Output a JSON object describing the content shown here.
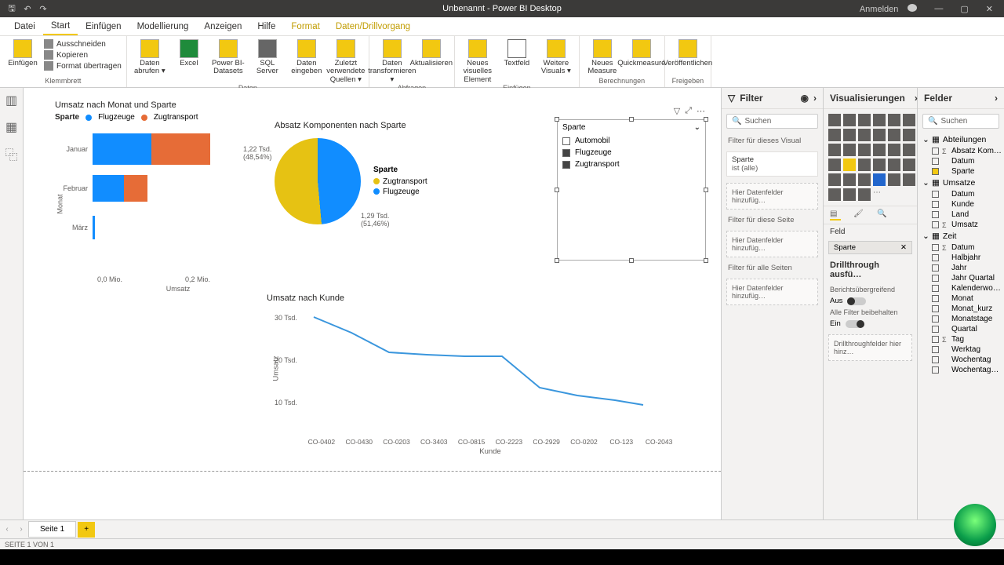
{
  "titlebar": {
    "title": "Unbenannt - Power BI Desktop",
    "signin": "Anmelden"
  },
  "tabs": {
    "file": "Datei",
    "start": "Start",
    "insert": "Einfügen",
    "model": "Modellierung",
    "view": "Anzeigen",
    "help": "Hilfe",
    "format": "Format",
    "data": "Daten/Drillvorgang"
  },
  "ribbon": {
    "clipboard_group": "Klemmbrett",
    "paste": "Einfügen",
    "cut": "Ausschneiden",
    "copy": "Kopieren",
    "format_painter": "Format übertragen",
    "data_group": "Daten",
    "get_data": "Daten abrufen ▾",
    "excel": "Excel",
    "pbi_ds": "Power BI-Datasets",
    "sql": "SQL Server",
    "enter_data": "Daten eingeben",
    "recent": "Zuletzt verwendete Quellen ▾",
    "queries_group": "Abfragen",
    "transform": "Daten transformieren ▾",
    "refresh": "Aktualisieren",
    "insert_group": "Einfügen",
    "new_visual": "Neues visuelles Element",
    "textbox": "Textfeld",
    "more_visuals": "Weitere Visuals ▾",
    "calc_group": "Berechnungen",
    "new_measure": "Neues Measure",
    "quick_measure": "Quickmeasure",
    "share_group": "Freigeben",
    "publish": "Veröffentlichen"
  },
  "chart_data": [
    {
      "id": "bar",
      "type": "bar",
      "title": "Umsatz nach Monat und Sparte",
      "legend_title": "Sparte",
      "series_names": [
        "Flugzeuge",
        "Zugtransport"
      ],
      "series_colors": [
        "#118dff",
        "#e66c37"
      ],
      "categories": [
        "Januar",
        "Februar",
        "März"
      ],
      "series": [
        {
          "name": "Flugzeuge",
          "values": [
            0.13,
            0.07,
            0.005
          ]
        },
        {
          "name": "Zugtransport",
          "values": [
            0.13,
            0.05,
            0.0
          ]
        }
      ],
      "xlabel": "Umsatz",
      "ylabel": "Monat",
      "xticks": [
        "0,0 Mio.",
        "0,2 Mio."
      ]
    },
    {
      "id": "pie",
      "type": "pie",
      "title": "Absatz Komponenten nach Sparte",
      "legend_title": "Sparte",
      "slices": [
        {
          "name": "Zugtransport",
          "value": 1290,
          "pct": 51.46,
          "label": "1,29 Tsd.\n(51,46%)",
          "color": "#e6c213"
        },
        {
          "name": "Flugzeuge",
          "value": 1220,
          "pct": 48.54,
          "label": "1,22 Tsd.\n(48,54%)",
          "color": "#118dff"
        }
      ]
    },
    {
      "id": "slicer",
      "type": "table",
      "title": "Sparte",
      "items": [
        "Automobil",
        "Flugzeuge",
        "Zugtransport"
      ]
    },
    {
      "id": "line",
      "type": "line",
      "title": "Umsatz nach Kunde",
      "xlabel": "Kunde",
      "ylabel": "Umsatz",
      "yticks": [
        "30 Tsd.",
        "20 Tsd.",
        "10 Tsd."
      ],
      "categories": [
        "CO-0402",
        "CO-0430",
        "CO-0203",
        "CO-3403",
        "CO-0815",
        "CO-2223",
        "CO-2929",
        "CO-0202",
        "CO-123",
        "CO-2043"
      ],
      "values": [
        30000,
        26000,
        22000,
        21500,
        21000,
        21000,
        14000,
        12000,
        11000,
        10000
      ]
    }
  ],
  "filter_pane": {
    "title": "Filter",
    "search": "Suchen",
    "section_visual": "Filter für dieses Visual",
    "card_field": "Sparte",
    "card_state": "ist (alle)",
    "drop_hint": "Hier Datenfelder hinzufüg…",
    "section_page": "Filter für diese Seite",
    "section_all": "Filter für alle Seiten"
  },
  "viz_pane": {
    "title": "Visualisierungen",
    "field_label": "Feld",
    "field_value": "Sparte",
    "drill_header": "Drillthrough ausfü…",
    "cross_report": "Berichtsübergreifend",
    "cross_off": "Aus",
    "keep_filters": "Alle Filter beibehalten",
    "keep_on": "Ein",
    "drill_drop": "Drillthroughfelder hier hinz…"
  },
  "fields_pane": {
    "title": "Felder",
    "search": "Suchen",
    "tables": [
      {
        "name": "Abteilungen",
        "fields": [
          {
            "name": "Absatz Kom…",
            "sigma": true,
            "checked": false
          },
          {
            "name": "Datum",
            "checked": false
          },
          {
            "name": "Sparte",
            "checked": true
          }
        ]
      },
      {
        "name": "Umsatze",
        "fields": [
          {
            "name": "Datum",
            "checked": false
          },
          {
            "name": "Kunde",
            "checked": false
          },
          {
            "name": "Land",
            "checked": false
          },
          {
            "name": "Umsatz",
            "sigma": true,
            "checked": false
          }
        ]
      },
      {
        "name": "Zeit",
        "fields": [
          {
            "name": "Datum",
            "sigma": true,
            "checked": false
          },
          {
            "name": "Halbjahr",
            "checked": false
          },
          {
            "name": "Jahr",
            "checked": false
          },
          {
            "name": "Jahr Quartal",
            "checked": false
          },
          {
            "name": "Kalenderwo…",
            "checked": false
          },
          {
            "name": "Monat",
            "checked": false
          },
          {
            "name": "Monat_kurz",
            "checked": false
          },
          {
            "name": "Monatstage",
            "checked": false
          },
          {
            "name": "Quartal",
            "checked": false
          },
          {
            "name": "Tag",
            "sigma": true,
            "checked": false
          },
          {
            "name": "Werktag",
            "checked": false
          },
          {
            "name": "Wochentag",
            "checked": false
          },
          {
            "name": "Wochentag…",
            "checked": false
          }
        ]
      }
    ]
  },
  "page": {
    "tab": "Seite 1",
    "status": "SEITE 1 VON 1"
  }
}
